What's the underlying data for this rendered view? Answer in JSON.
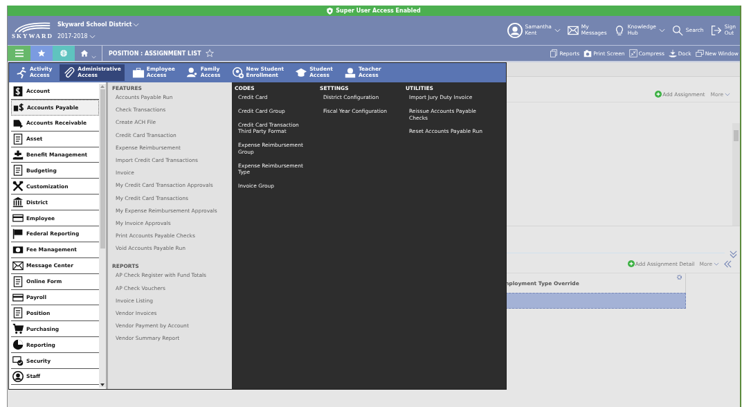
{
  "banner": {
    "text": "Super User Access Enabled"
  },
  "header": {
    "logo": "SKYWARD",
    "district": "Skyward School District",
    "year": "2017-2018",
    "user": {
      "first": "Samantha",
      "last": "Kent"
    },
    "links": [
      {
        "kind": "messages",
        "line1": "My",
        "line2": "Messages",
        "caret": false
      },
      {
        "kind": "hub",
        "line1": "Knowledge",
        "line2": "Hub",
        "caret": true
      },
      {
        "kind": "search",
        "line1": "Search",
        "caret": false
      },
      {
        "kind": "signout",
        "line1": "Sign",
        "line2": "Out",
        "caret": false
      }
    ]
  },
  "toolbar": {
    "page_title": "POSITION : ASSIGNMENT LIST",
    "actions": [
      {
        "kind": "reports",
        "label": "Reports"
      },
      {
        "kind": "camera",
        "label": "Print Screen"
      },
      {
        "kind": "compress",
        "label": "Compress"
      },
      {
        "kind": "dock",
        "label": "Dock"
      },
      {
        "kind": "window",
        "label": "New Window"
      }
    ]
  },
  "access_tabs": [
    {
      "line1": "Activity",
      "line2": "Access",
      "selected": false
    },
    {
      "line1": "Administrative",
      "line2": "Access",
      "selected": true
    },
    {
      "line1": "Employee",
      "line2": "Access",
      "selected": false
    },
    {
      "line1": "Family",
      "line2": "Access",
      "selected": false
    },
    {
      "line1": "New Student",
      "line2": "Enrollment",
      "selected": false
    },
    {
      "line1": "Student",
      "line2": "Access",
      "selected": false
    },
    {
      "line1": "Teacher",
      "line2": "Access",
      "selected": false
    }
  ],
  "modules": [
    {
      "label": "Account",
      "selected": false
    },
    {
      "label": "Accounts Payable",
      "selected": true
    },
    {
      "label": "Accounts Receivable",
      "selected": false
    },
    {
      "label": "Asset",
      "selected": false
    },
    {
      "label": "Benefit Management",
      "selected": false
    },
    {
      "label": "Budgeting",
      "selected": false
    },
    {
      "label": "Customization",
      "selected": false
    },
    {
      "label": "District",
      "selected": false
    },
    {
      "label": "Employee",
      "selected": false
    },
    {
      "label": "Federal Reporting",
      "selected": false
    },
    {
      "label": "Fee Management",
      "selected": false
    },
    {
      "label": "Message Center",
      "selected": false
    },
    {
      "label": "Online Form",
      "selected": false
    },
    {
      "label": "Payroll",
      "selected": false
    },
    {
      "label": "Position",
      "selected": false
    },
    {
      "label": "Purchasing",
      "selected": false
    },
    {
      "label": "Reporting",
      "selected": false
    },
    {
      "label": "Security",
      "selected": false
    },
    {
      "label": "Staff",
      "selected": false
    }
  ],
  "light_sections": [
    {
      "title": "FEATURES",
      "items": [
        "Accounts Payable Run",
        "Check Transactions",
        "Create ACH File",
        "Credit Card Transaction",
        "Expense Reimbursement",
        "Import Credit Card Transactions",
        "Invoice",
        "My Credit Card Transaction Approvals",
        "My Credit Card Transactions",
        "My Expense Reimbursement Approvals",
        "My Invoice Approvals",
        "Print Accounts Payable Checks",
        "Void Accounts Payable Run"
      ]
    },
    {
      "title": "REPORTS",
      "items": [
        "AP Check Register with Fund Totals",
        "AP Check Vouchers",
        "Invoice Listing",
        "Vendor Invoices",
        "Vendor Payment by Account",
        "Vendor Summary Report"
      ]
    }
  ],
  "dark_sections": [
    {
      "title": "CODES",
      "items": [
        "Credit Card",
        "Credit Card Group",
        "Credit Card Transaction Third Party Format",
        "Expense Reimbursement Group",
        "Expense Reimbursement Type",
        "Invoice Group"
      ]
    },
    {
      "title": "SETTINGS",
      "items": [
        "District Configuration",
        "Fiscal Year Configuration"
      ]
    },
    {
      "title": "UTILITIES",
      "items": [
        "Import Jury Duty Invoice",
        "Reissue Accounts Payable Checks",
        "Reset Accounts Payable Run"
      ]
    }
  ],
  "assignments": {
    "add": "Add Assignment",
    "more": "More"
  },
  "details": {
    "add": "Add Assignment Detail",
    "more": "More",
    "column": "nployment Type Override"
  }
}
